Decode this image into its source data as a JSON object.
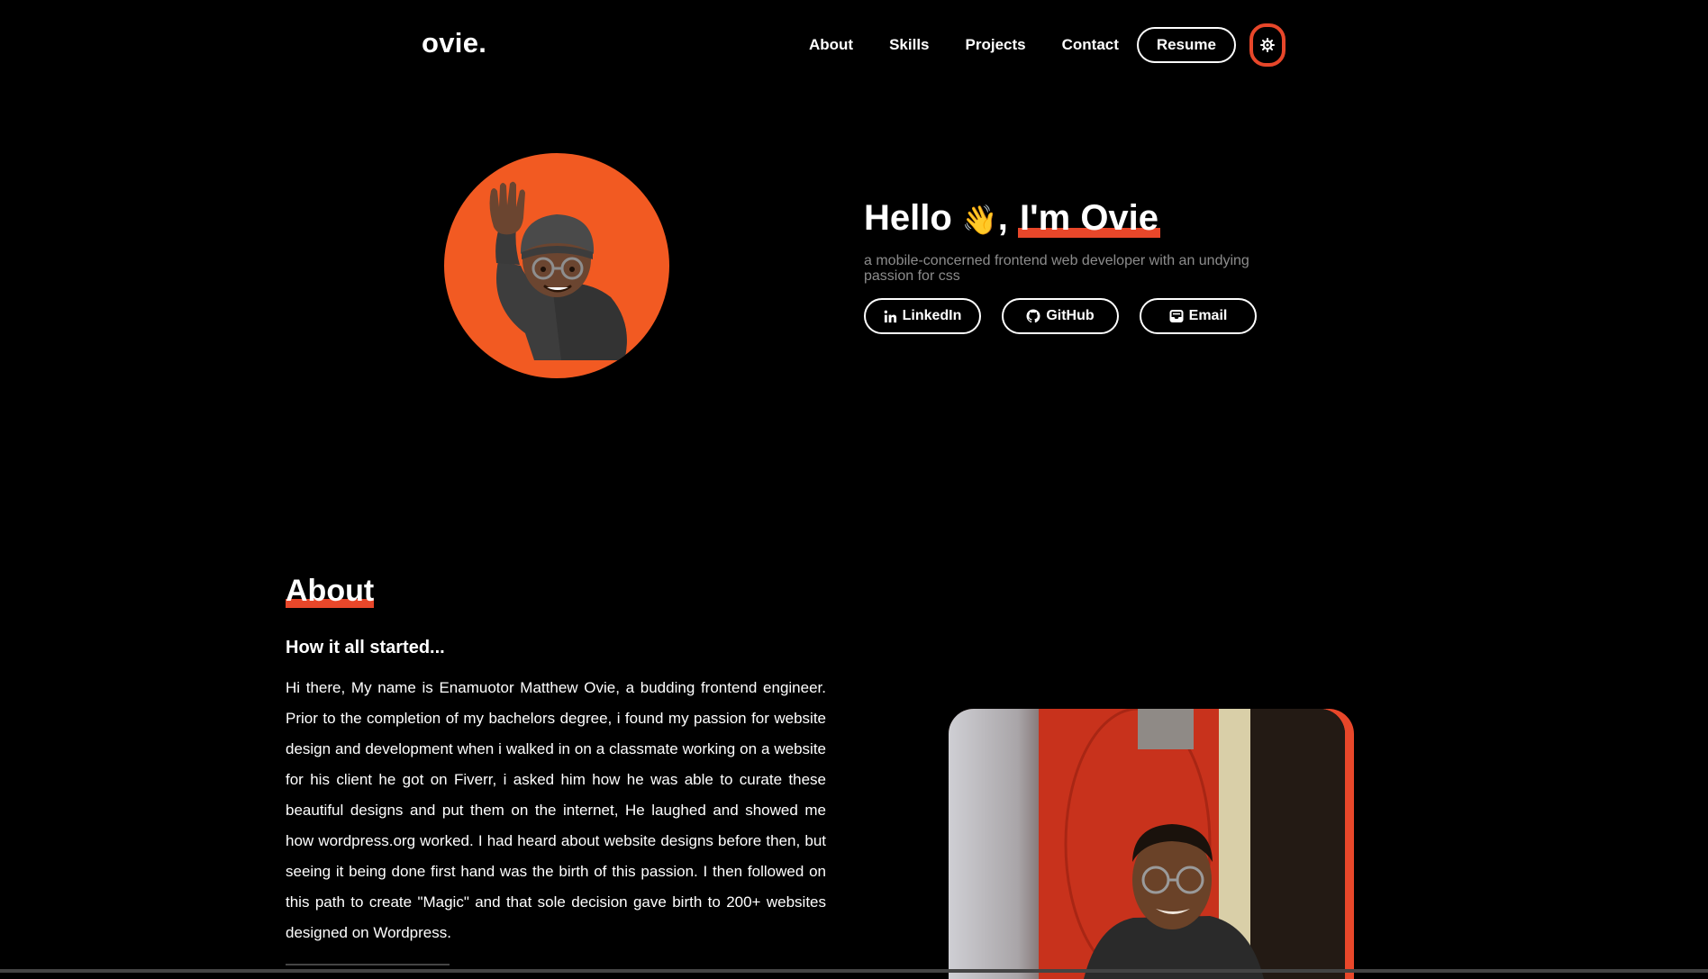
{
  "nav": {
    "logo": "ovie.",
    "links": [
      "About",
      "Skills",
      "Projects",
      "Contact"
    ],
    "resume_label": "Resume",
    "theme_toggle_icon": "gear-icon"
  },
  "hero": {
    "greeting": "Hello",
    "wave_emoji": "👋",
    "comma": ",",
    "name_highlight": "I'm Ovie",
    "subtitle": "a mobile-concerned frontend web developer with an undying passion for css",
    "socials": [
      {
        "label": "LinkedIn",
        "icon": "linkedin-icon"
      },
      {
        "label": "GitHub",
        "icon": "github-icon"
      },
      {
        "label": "Email",
        "icon": "email-icon"
      }
    ]
  },
  "about": {
    "heading": "About",
    "subheading": "How it all started...",
    "paragraph": "Hi there, My name is Enamuotor Matthew Ovie, a budding frontend engineer. Prior to the completion of my bachelors degree, i found my passion for website design and development when i walked in on a classmate working on a website for his client he got on Fiverr, i asked him how he was able to curate these beautiful designs and put them on the internet, He laughed and showed me how wordpress.org worked. I had heard about website designs before then, but seeing it being done first hand was the birth of this passion. I then followed on this path to create \"Magic\" and that sole decision gave birth to 200+ websites designed on Wordpress."
  },
  "colors": {
    "accent": "#e8472a",
    "avatar_bg": "#f25a22",
    "background": "#000000",
    "muted_text": "#8c8c8c"
  }
}
